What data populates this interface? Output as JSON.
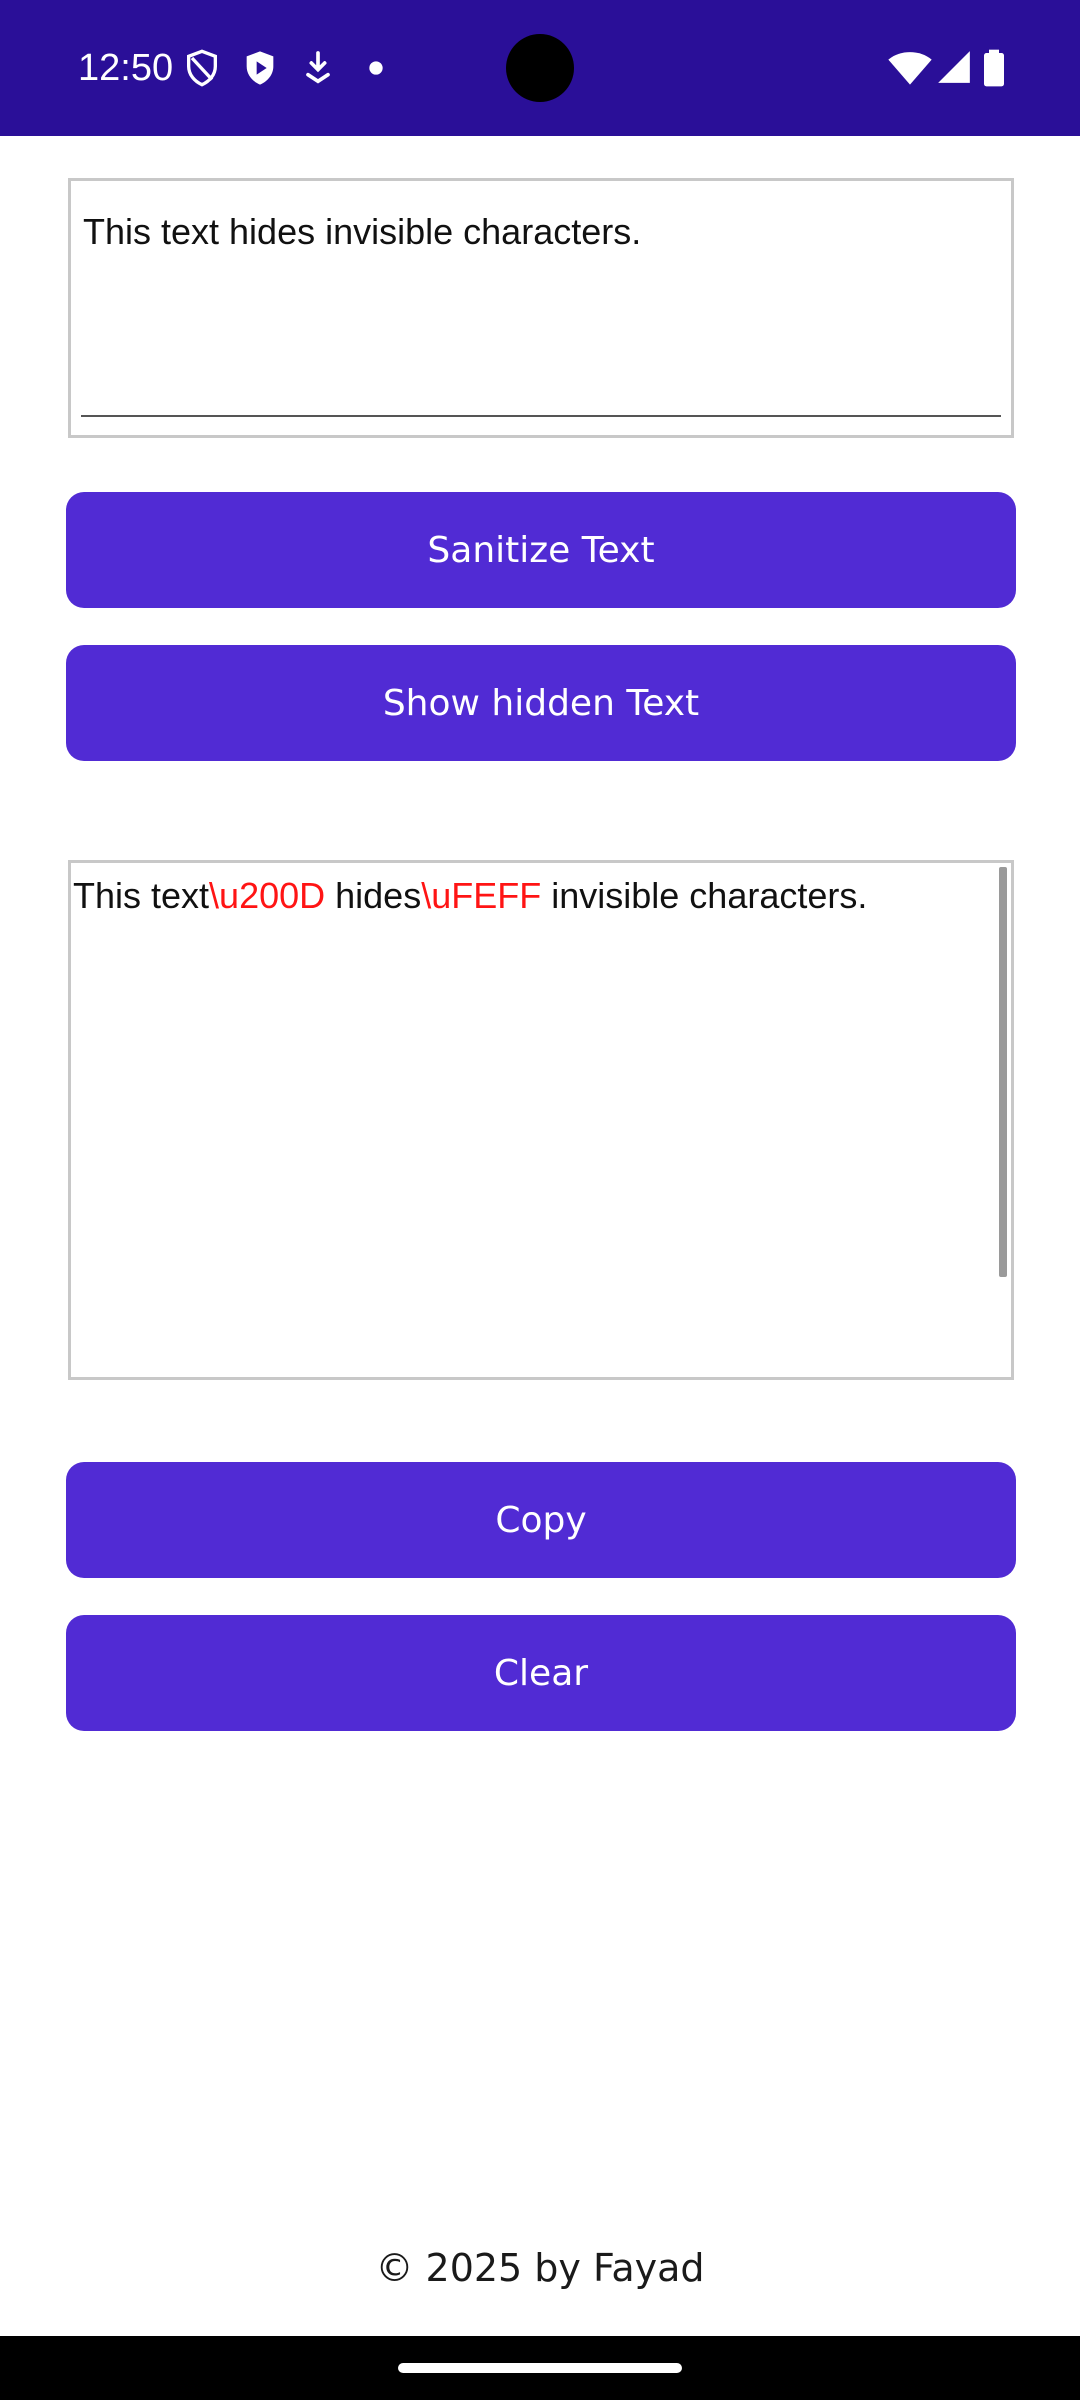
{
  "status_bar": {
    "time": "12:50",
    "left_icons": [
      "shield-outline-icon",
      "play-shield-icon",
      "download-icon",
      "dot-icon"
    ],
    "right_icons": [
      "wifi-icon",
      "signal-icon",
      "battery-icon"
    ]
  },
  "input": {
    "text": "This text hides invisible characters."
  },
  "buttons": {
    "sanitize": "Sanitize Text",
    "show_hidden": "Show hidden Text",
    "copy": "Copy",
    "clear": "Clear"
  },
  "output": {
    "segment_1": "This text",
    "hidden_1": "\\u200D",
    "segment_2": " hides",
    "hidden_2": "\\uFEFF",
    "segment_3": " invisible characters."
  },
  "footer": {
    "text": "© 2025 by Fayad"
  },
  "colors": {
    "status_bar": "#2a0f98",
    "button": "#512bd4",
    "hidden_char": "#ff1414"
  }
}
